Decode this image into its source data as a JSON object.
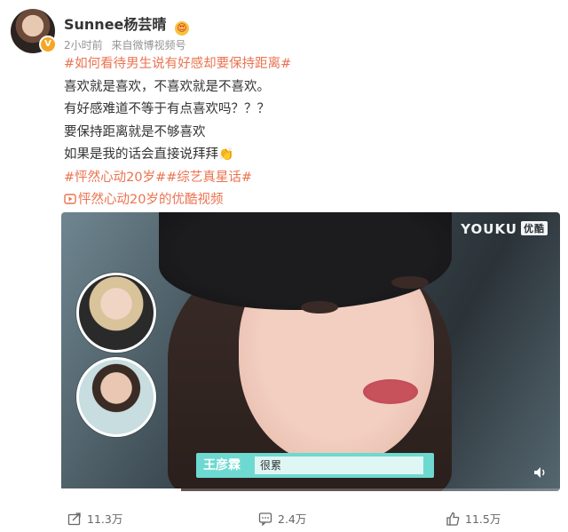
{
  "post": {
    "author": "Sunnee杨芸晴",
    "author_badge": "V",
    "emoji_badge": "😍",
    "time": "2小时前",
    "source_prefix": "来自",
    "source": "微博视频号",
    "lines": [
      "#如何看待男生说有好感却要保持距离#",
      "喜欢就是喜欢，不喜欢就是不喜欢。",
      "有好感难道不等于有点喜欢吗？？？",
      "要保持距离就是不够喜欢",
      "如果是我的话会直接说拜拜",
      "#怦然心动20岁##综艺真星话#",
      "怦然心动20岁的优酷视频"
    ],
    "clap_emoji": "👏",
    "video_link_icon": "video-play-icon"
  },
  "video": {
    "brand": "YOUKU",
    "brand_cn": "优酷",
    "subtitle_name": "王彦霖",
    "subtitle_text": "很累",
    "progress": 0.24,
    "volume_icon": "volume-icon"
  },
  "actions": {
    "share_count": "11.3万",
    "comment_count": "2.4万",
    "like_count": "11.5万"
  },
  "colors": {
    "link": "#eb7350",
    "subtitle_bar": "#6ed9d0"
  }
}
